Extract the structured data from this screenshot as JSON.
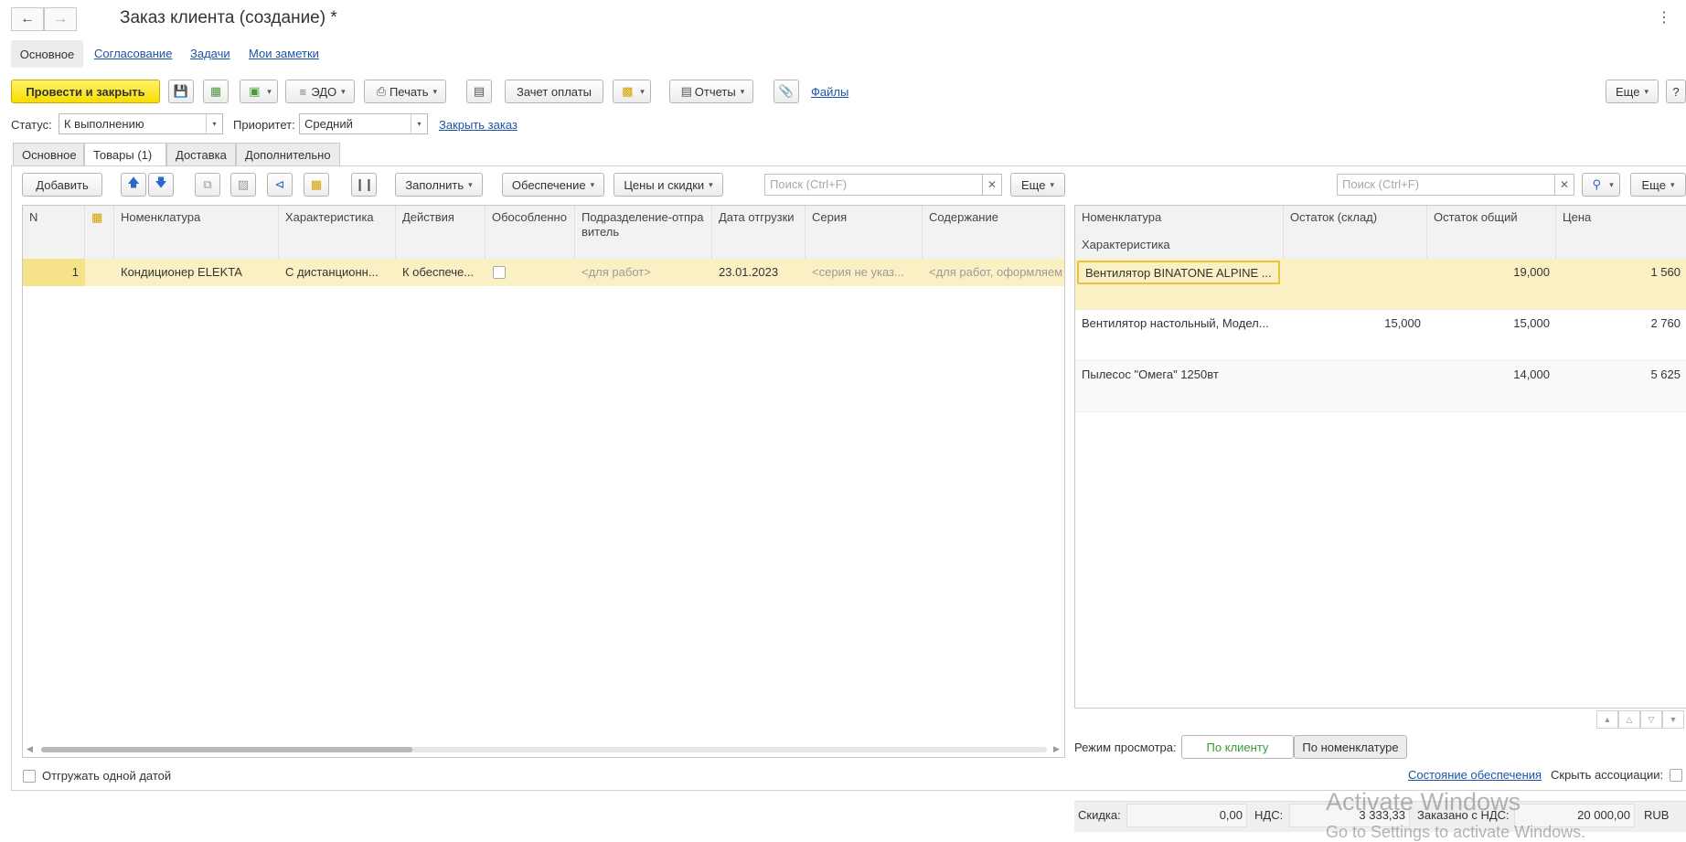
{
  "window": {
    "title": "Заказ клиента (создание) *"
  },
  "nav_tabs": [
    "Основное",
    "Согласование",
    "Задачи",
    "Мои заметки"
  ],
  "toolbar": {
    "post_close": "Провести и закрыть",
    "edo": "ЭДО",
    "print": "Печать",
    "payment_offset": "Зачет оплаты",
    "reports": "Отчеты",
    "files": "Файлы",
    "more": "Еще",
    "help": "?"
  },
  "status_row": {
    "status_label": "Статус:",
    "status_value": "К выполнению",
    "priority_label": "Приоритет:",
    "priority_value": "Средний",
    "close_order": "Закрыть заказ"
  },
  "form_tabs": [
    "Основное",
    "Товары (1)",
    "Доставка",
    "Дополнительно"
  ],
  "goods": {
    "add": "Добавить",
    "fill": "Заполнить",
    "supply": "Обеспечение",
    "prices": "Цены и скидки",
    "search_placeholder": "Поиск (Ctrl+F)",
    "more": "Еще",
    "columns": [
      "N",
      "Номенклатура",
      "Характеристика",
      "Действия",
      "Обособленно",
      "Подразделение-отправитель",
      "Дата отгрузки",
      "Серия",
      "Содержание"
    ],
    "rows": [
      {
        "n": "1",
        "item": "Кондиционер ELEKTA",
        "characteristic": "С дистанционн...",
        "action": "К обеспече...",
        "division": "<для работ>",
        "date": "23.01.2023",
        "series": "<серия не указ...",
        "content": "<для работ, оформляем"
      }
    ]
  },
  "assoc": {
    "search_placeholder": "Поиск (Ctrl+F)",
    "more": "Еще",
    "columns": [
      "Номенклатура",
      "Характеристика",
      "Остаток (склад)",
      "Остаток общий",
      "Цена"
    ],
    "rows": [
      {
        "item": "Вентилятор BINATONE ALPINE ...",
        "stock_wh": "",
        "stock_total": "19,000",
        "price": "1 560"
      },
      {
        "item": "Вентилятор настольный, Модел...",
        "stock_wh": "15,000",
        "stock_total": "15,000",
        "price": "2 760"
      },
      {
        "item": "Пылесос \"Омега\" 1250вт",
        "stock_wh": "",
        "stock_total": "14,000",
        "price": "5 625"
      }
    ],
    "view_mode_label": "Режим просмотра:",
    "view_by_client": "По клиенту",
    "view_by_item": "По номенклатуре",
    "supply_state": "Состояние обеспечения",
    "hide_assoc": "Скрыть ассоциации:"
  },
  "ship_one_date": "Отгружать одной датой",
  "totals": {
    "discount_label": "Скидка:",
    "discount_value": "0,00",
    "vat_label": "НДС:",
    "vat_value": "3 333,33",
    "ordered_label": "Заказано с НДС:",
    "ordered_value": "20 000,00",
    "currency": "RUB"
  },
  "watermark": {
    "line1": "Activate Windows",
    "line2": "Go to Settings to activate Windows."
  },
  "colors": {
    "accent_yellow": "#f7dd00",
    "selected_row": "#fbf0c4",
    "link": "#1c54a8",
    "green": "#3a9a3a"
  }
}
